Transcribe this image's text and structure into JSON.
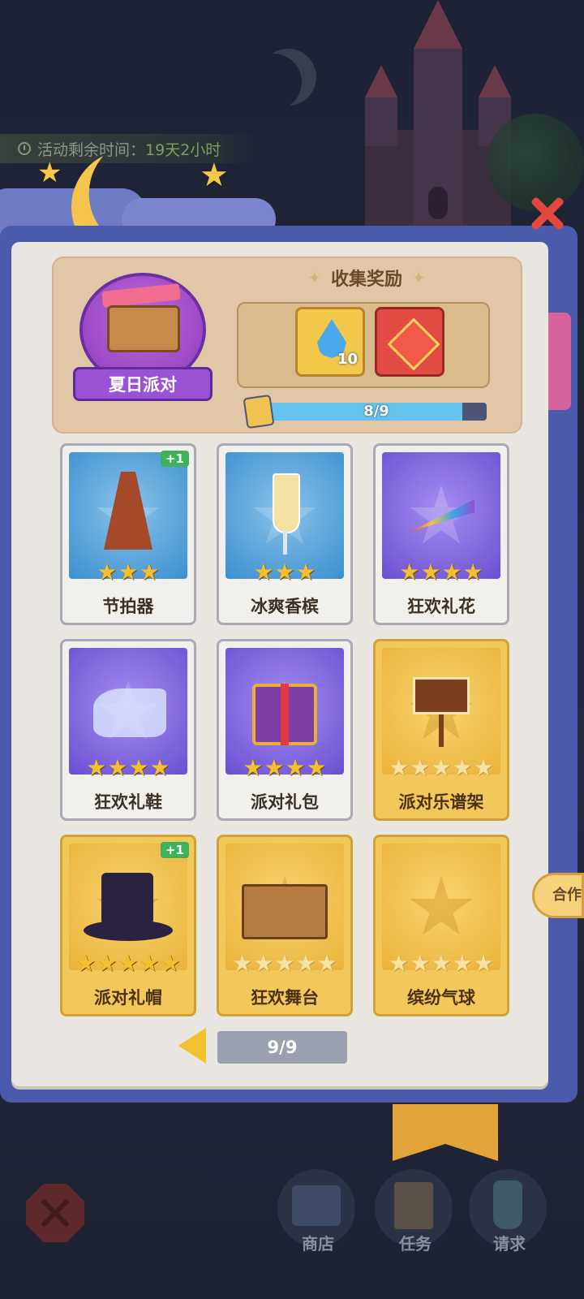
{
  "event": {
    "timer_label": "活动剩余时间：",
    "timer_value": "19天2小时"
  },
  "collection": {
    "badge_title": "夏日派对",
    "reward_title": "收集奖励",
    "rewards": [
      {
        "icon": "water-drop-icon",
        "count": "10"
      },
      {
        "icon": "red-gem-icon"
      }
    ],
    "progress_text": "8/9",
    "progress_value": 0.89
  },
  "cards": [
    {
      "name": "节拍器",
      "stars": 3,
      "max_stars": 3,
      "theme": "blue",
      "plus": "+1",
      "icon": "metronome-icon"
    },
    {
      "name": "冰爽香槟",
      "stars": 3,
      "max_stars": 3,
      "theme": "blue",
      "plus": null,
      "icon": "champagne-icon"
    },
    {
      "name": "狂欢礼花",
      "stars": 4,
      "max_stars": 4,
      "theme": "purple",
      "plus": null,
      "icon": "party-popper-icon"
    },
    {
      "name": "狂欢礼鞋",
      "stars": 4,
      "max_stars": 4,
      "theme": "purple",
      "plus": null,
      "icon": "glass-shoes-icon"
    },
    {
      "name": "派对礼包",
      "stars": 4,
      "max_stars": 4,
      "theme": "purple",
      "plus": null,
      "icon": "gift-box-icon"
    },
    {
      "name": "派对乐谱架",
      "stars": 0,
      "max_stars": 5,
      "theme": "gold",
      "plus": null,
      "icon": "music-stand-icon"
    },
    {
      "name": "派对礼帽",
      "stars": 5,
      "max_stars": 5,
      "theme": "gold",
      "plus": "+1",
      "icon": "top-hat-icon"
    },
    {
      "name": "狂欢舞台",
      "stars": 0,
      "max_stars": 5,
      "theme": "gold",
      "plus": null,
      "icon": "stage-icon"
    },
    {
      "name": "缤纷气球",
      "stars": 0,
      "max_stars": 5,
      "theme": "gold",
      "plus": null,
      "icon": "placeholder-star-icon"
    }
  ],
  "pager": {
    "text": "9/9"
  },
  "side_tab": {
    "label": "合作"
  },
  "nav": [
    {
      "label": "商店",
      "icon": "shop-icon"
    },
    {
      "label": "任务",
      "icon": "clipboard-icon"
    },
    {
      "label": "请求",
      "icon": "bottle-icon"
    }
  ],
  "colors": {
    "accent_gold": "#f3c85a",
    "progress": "#64c3ec",
    "close_red": "#e4473b"
  }
}
